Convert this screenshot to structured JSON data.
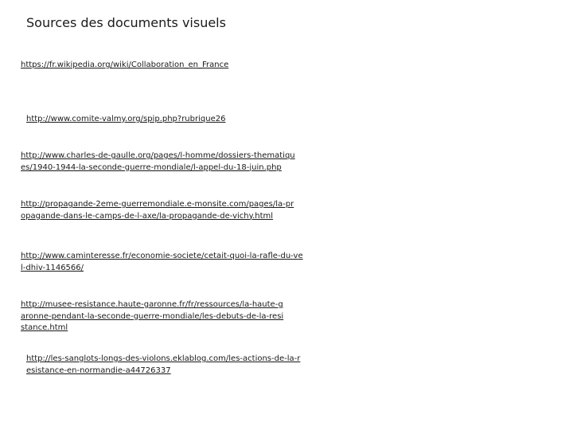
{
  "title": "Sources des documents visuels",
  "links": [
    "https://fr.wikipedia.org/wiki/Collaboration_en_France",
    "http://www.comite-valmy.org/spip.php?rubrique26",
    "http://www.charles-de-gaulle.org/pages/l-homme/dossiers-thematiques/1940-1944-la-seconde-guerre-mondiale/l-appel-du-18-juin.php",
    "http://propagande-2eme-guerremondiale.e-monsite.com/pages/la-propagande-dans-le-camps-de-l-axe/la-propagande-de-vichy.html",
    "http://www.caminteresse.fr/economie-societe/cetait-quoi-la-rafle-du-vel-dhiv-1146566/",
    "http://musee-resistance.haute-garonne.fr/fr/ressources/la-haute-garonne-pendant-la-seconde-guerre-mondiale/les-debuts-de-la-resistance.html",
    "http://les-sanglots-longs-des-violons.eklablog.com/les-actions-de-la-resistance-en-normandie-a44726337"
  ]
}
